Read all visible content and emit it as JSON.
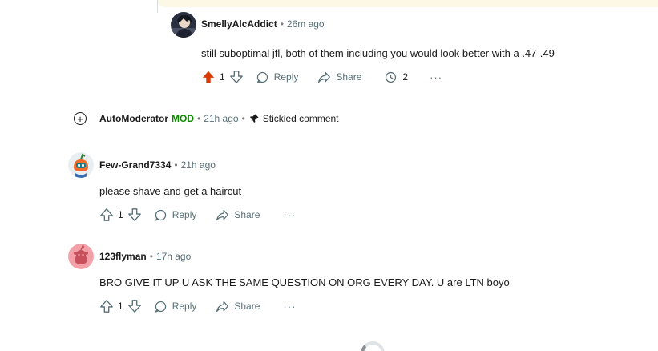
{
  "comments": [
    {
      "username": "SmellyAlcAddict",
      "time": "26m ago",
      "body": "still suboptimal jfl, both of them including you would look better with a .47-.49",
      "votes": "1",
      "upvoted": true,
      "reply_label": "Reply",
      "share_label": "Share",
      "awards_count": "2",
      "more_label": "···"
    },
    {
      "username": "AutoModerator",
      "mod_label": "MOD",
      "time": "21h ago",
      "sticky_label": "Stickied comment",
      "expand_label": "+"
    },
    {
      "username": "Few-Grand7334",
      "time": "21h ago",
      "body": "please shave and get a haircut",
      "votes": "1",
      "reply_label": "Reply",
      "share_label": "Share",
      "more_label": "···"
    },
    {
      "username": "123flyman",
      "time": "17h ago",
      "body": "BRO GIVE IT UP U ASK THE SAME QUESTION ON ORG EVERY DAY. U are LTN boyo",
      "votes": "1",
      "reply_label": "Reply",
      "share_label": "Share",
      "more_label": "···"
    }
  ],
  "separator": "•",
  "colors": {
    "upvote_active": "#d93a00",
    "mod_green": "#0e8a00",
    "muted": "#576f76",
    "highlight_bg": "#fdf7e6"
  },
  "icons": [
    "upvote-icon",
    "downvote-icon",
    "reply-icon",
    "share-icon",
    "award-icon",
    "pin-icon",
    "expand-icon"
  ]
}
